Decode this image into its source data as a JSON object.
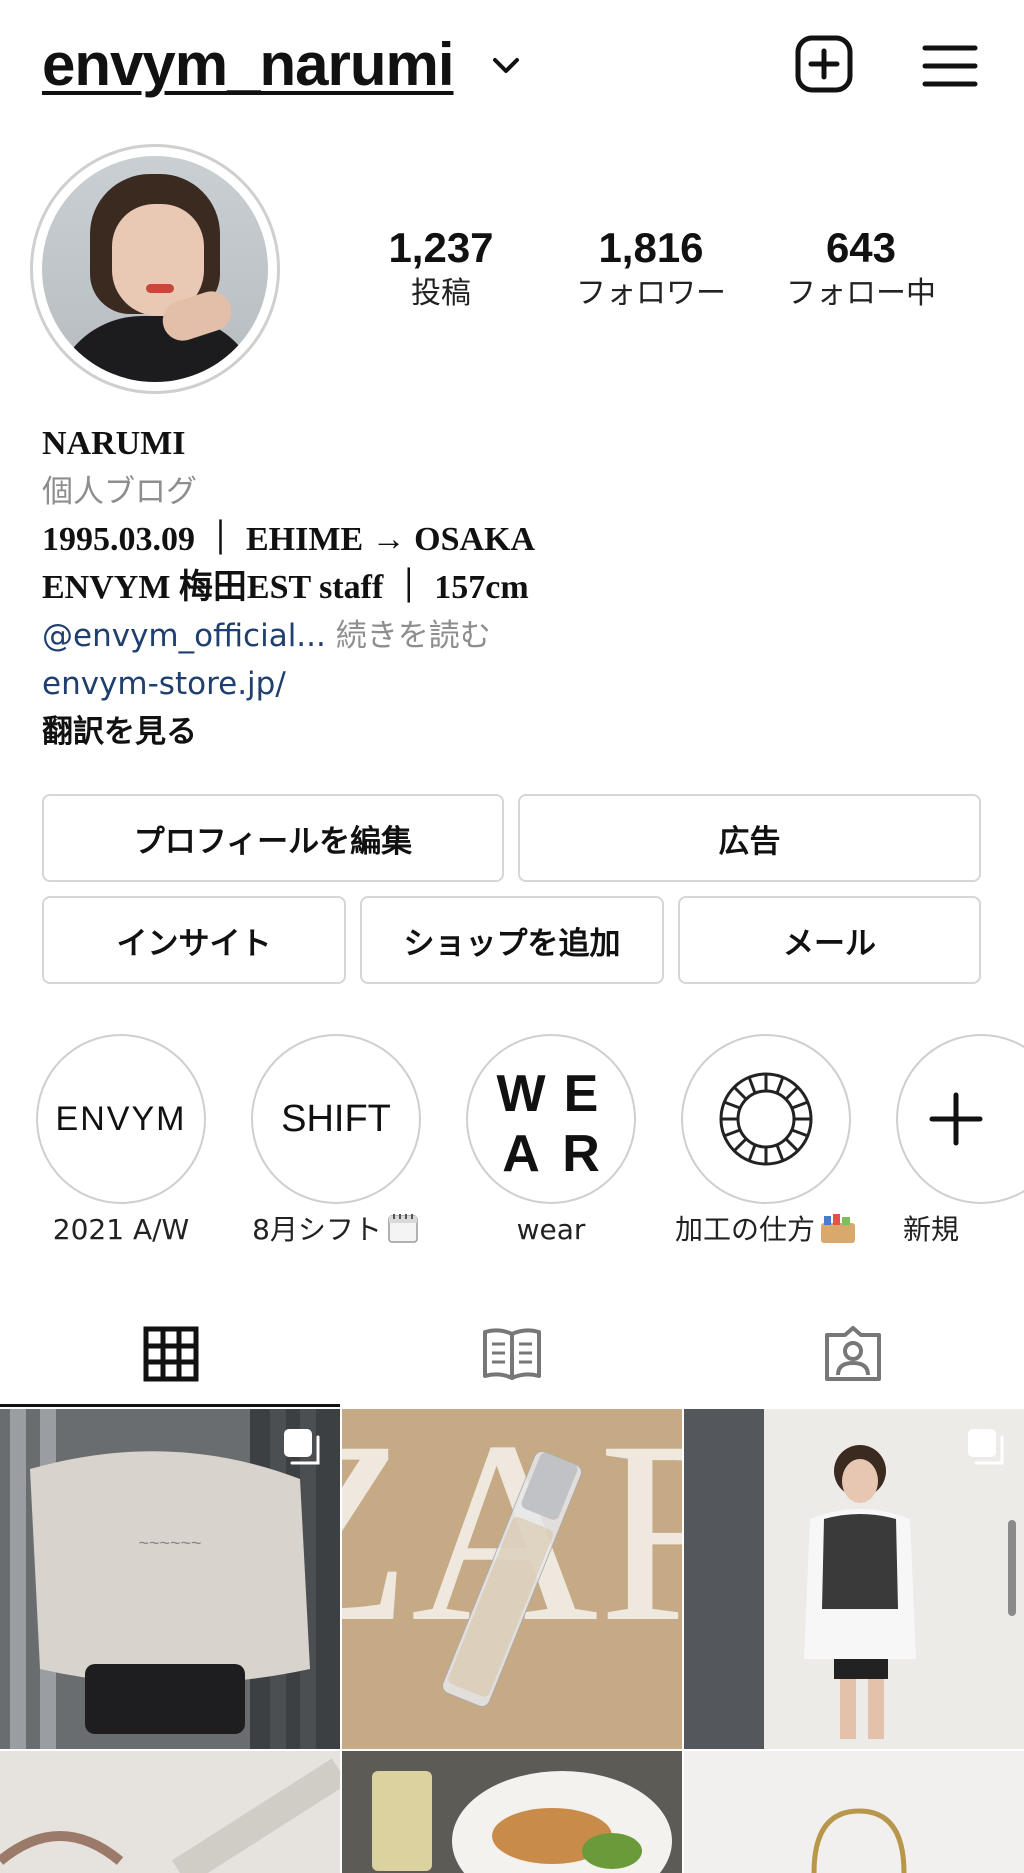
{
  "header": {
    "username": "envym_narumi",
    "icons": {
      "dropdown": "chevron-down-icon",
      "new_post": "plus-square-icon",
      "menu": "hamburger-menu-icon"
    }
  },
  "stats": [
    {
      "value": "1,237",
      "label": "投稿"
    },
    {
      "value": "1,816",
      "label": "フォロワー"
    },
    {
      "value": "643",
      "label": "フォロー中"
    }
  ],
  "bio": {
    "name": "NARUMI",
    "category": "個人ブログ",
    "line1": "1995.03.09 ｜ EHIME → OSAKA",
    "line2": "ENVYM 梅田EST staff ｜ 157cm",
    "mention": "@envym_official...",
    "read_more": " 続きを読む",
    "website": "envym-store.jp/",
    "translate": "翻訳を見る"
  },
  "buttons": {
    "edit_profile": "プロフィールを編集",
    "ads": "広告",
    "insights": "インサイト",
    "add_shop": "ショップを追加",
    "email": "メール"
  },
  "highlights": [
    {
      "cover_text": "ENVYM",
      "label": "2021 A/W"
    },
    {
      "cover_text": "SHIFT",
      "label": "8月シフト"
    },
    {
      "cover_text": "WEAR",
      "label": "wear"
    },
    {
      "cover_text": "",
      "label": "加工の仕方"
    },
    {
      "cover_text": "+",
      "label": "新規"
    }
  ],
  "tabs": [
    {
      "icon": "grid-icon",
      "active": true
    },
    {
      "icon": "guide-book-icon",
      "active": false
    },
    {
      "icon": "tagged-person-icon",
      "active": false
    }
  ],
  "colors": {
    "link": "#1f3f6e",
    "muted": "#8e8e8e",
    "border": "#d6d6d6",
    "text": "#111111"
  }
}
